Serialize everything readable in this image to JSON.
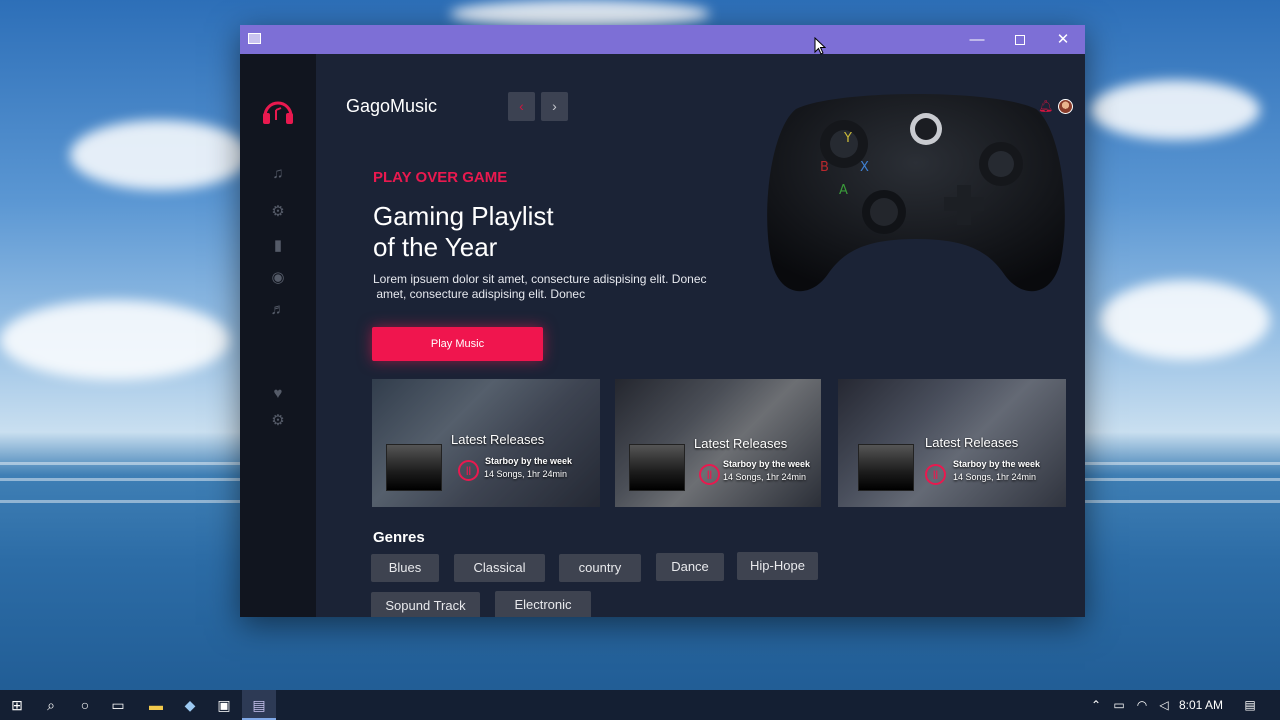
{
  "window": {
    "min_symbol": "—",
    "max_symbol": "",
    "close_symbol": "✕"
  },
  "app": {
    "name": "GagoMusic",
    "nav_back": "‹",
    "nav_forward": "›"
  },
  "hero": {
    "kicker": "PLAY OVER GAME",
    "headline_line1": "Gaming Playlist",
    "headline_line2": "of the Year",
    "description_line1": "Lorem ipsuem dolor sit amet, consecture adispising elit. Donec",
    "description_line2": " amet, consecture adispising elit. Donec",
    "button": "Play Music"
  },
  "cards": [
    {
      "title": "Latest Releases",
      "line1": "Starboy by the week",
      "line2": "14 Songs, 1hr 24min"
    },
    {
      "title": "Latest Releases",
      "line1": "Starboy by the week",
      "line2": "14 Songs, 1hr 24min"
    },
    {
      "title": "Latest Releases",
      "line1": "Starboy by the week",
      "line2": "14 Songs, 1hr 24min"
    }
  ],
  "genres": {
    "title": "Genres",
    "items": [
      "Blues",
      "Classical",
      "country",
      "Dance",
      "Hip-Hope",
      "Sopund Track",
      "Electronic"
    ]
  },
  "sidebar_icons": [
    "music-note-icon",
    "gear-icon",
    "document-icon",
    "gamepad-icon",
    "music-note-icon",
    "heart-icon",
    "gear-icon"
  ],
  "colors": {
    "accent": "#f0154e",
    "titlebar": "#7d6fd6",
    "sidebar": "#11151f",
    "main": "#1b2336"
  },
  "taskbar": {
    "time": "8:01 AM"
  }
}
